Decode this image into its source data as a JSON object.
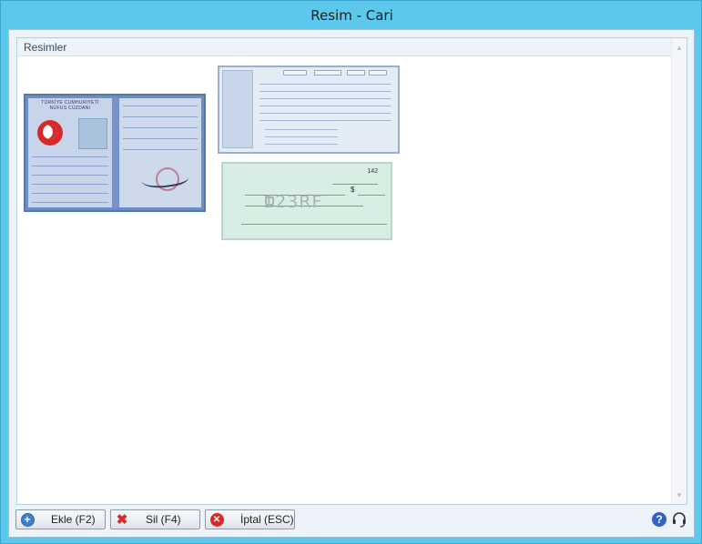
{
  "window": {
    "title": "Resim - Cari"
  },
  "panel": {
    "header": "Resimler"
  },
  "images": [
    {
      "name": "nufus-cuzdani",
      "header_line1": "TÜRKİYE CUMHURİYETİ",
      "header_line2": "NÜFUS CÜZDANI"
    },
    {
      "name": "form-document"
    },
    {
      "name": "cheque",
      "number": "142",
      "watermark": "123RF",
      "currency": "$"
    }
  ],
  "toolbar": {
    "add_label": "Ekle (F2)",
    "delete_label": "Sil (F4)",
    "cancel_label": "İptal (ESC)"
  },
  "icons": {
    "help": "?",
    "colors": {
      "accent": "#5bc8ec",
      "help": "#2f64c8",
      "delete": "#d42b2b"
    }
  }
}
